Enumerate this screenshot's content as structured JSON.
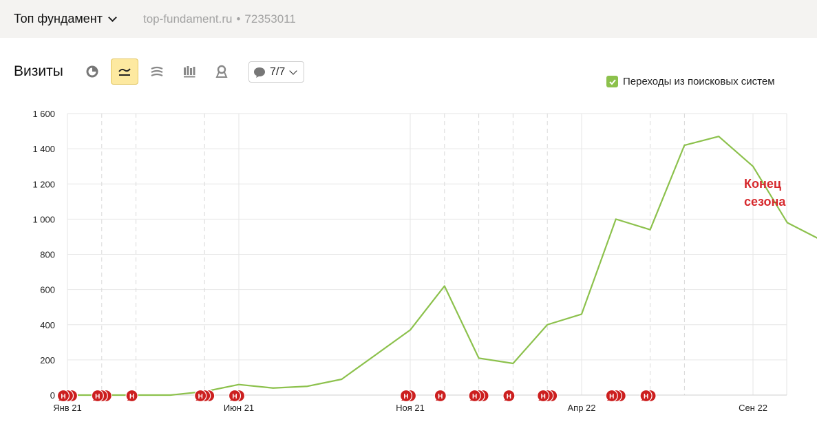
{
  "header": {
    "counter_name": "Топ фундамент",
    "site": "top-fundament.ru",
    "separator": "•",
    "counter_id": "72353011"
  },
  "toolbar": {
    "metric_title": "Визиты",
    "tools": [
      "pie-chart-icon",
      "line-chart-icon",
      "area-chart-icon",
      "bar-chart-icon",
      "map-icon"
    ],
    "active_tool": "line-chart-icon",
    "annotations_count": "7/7"
  },
  "legend": {
    "label": "Переходы из поисковых систем",
    "checked": true,
    "color": "#8cc14c"
  },
  "note": {
    "line1": "Конец",
    "line2": "сезона",
    "color": "#d6282c"
  },
  "chart_data": {
    "type": "line",
    "title": "",
    "xlabel": "",
    "ylabel": "",
    "ylim": [
      0,
      1600
    ],
    "y_ticks": [
      "0",
      "200",
      "400",
      "600",
      "800",
      "1 000",
      "1 200",
      "1 400",
      "1 600"
    ],
    "x_tick_labels": [
      {
        "label": "Янв 21",
        "month_index": 0
      },
      {
        "label": "Июн 21",
        "month_index": 5
      },
      {
        "label": "Ноя 21",
        "month_index": 10
      },
      {
        "label": "Апр 22",
        "month_index": 15
      },
      {
        "label": "Сен 22",
        "month_index": 20
      }
    ],
    "months": [
      "2021-01",
      "2021-02",
      "2021-03",
      "2021-04",
      "2021-05",
      "2021-06",
      "2021-07",
      "2021-08",
      "2021-09",
      "2021-10",
      "2021-11",
      "2021-12",
      "2022-01",
      "2022-02",
      "2022-03",
      "2022-04",
      "2022-05",
      "2022-06",
      "2022-07",
      "2022-08",
      "2022-09",
      "2022-10"
    ],
    "series": [
      {
        "name": "Переходы из поисковых систем",
        "color": "#8cc14c",
        "values": [
          0,
          0,
          0,
          0,
          20,
          60,
          40,
          50,
          90,
          230,
          370,
          620,
          210,
          180,
          400,
          460,
          1000,
          940,
          1420,
          1470,
          1300,
          980,
          880
        ]
      }
    ],
    "dashed_vertical_months": [
      1,
      2,
      4,
      11,
      12,
      13,
      14,
      17,
      18
    ],
    "annotation_markers": [
      {
        "month_index": 0,
        "count": 3,
        "letter": "Н"
      },
      {
        "month_index": 1,
        "count": 3,
        "letter": "Н"
      },
      {
        "month_index": 2,
        "count": 1,
        "letter": "Н"
      },
      {
        "month_index": 4,
        "count": 3,
        "letter": "Н"
      },
      {
        "month_index": 5,
        "count": 2,
        "letter": "Н"
      },
      {
        "month_index": 10,
        "count": 2,
        "letter": "Н"
      },
      {
        "month_index": 11,
        "count": 1,
        "letter": "Н"
      },
      {
        "month_index": 12,
        "count": 3,
        "letter": "Н"
      },
      {
        "month_index": 13,
        "count": 1,
        "letter": "Н"
      },
      {
        "month_index": 14,
        "count": 3,
        "letter": "Н"
      },
      {
        "month_index": 16,
        "count": 3,
        "letter": "Н"
      },
      {
        "month_index": 17,
        "count": 2,
        "letter": "Н"
      }
    ],
    "marker_color": "#cc1f1f",
    "grid": true,
    "legend_position": "top-right"
  }
}
